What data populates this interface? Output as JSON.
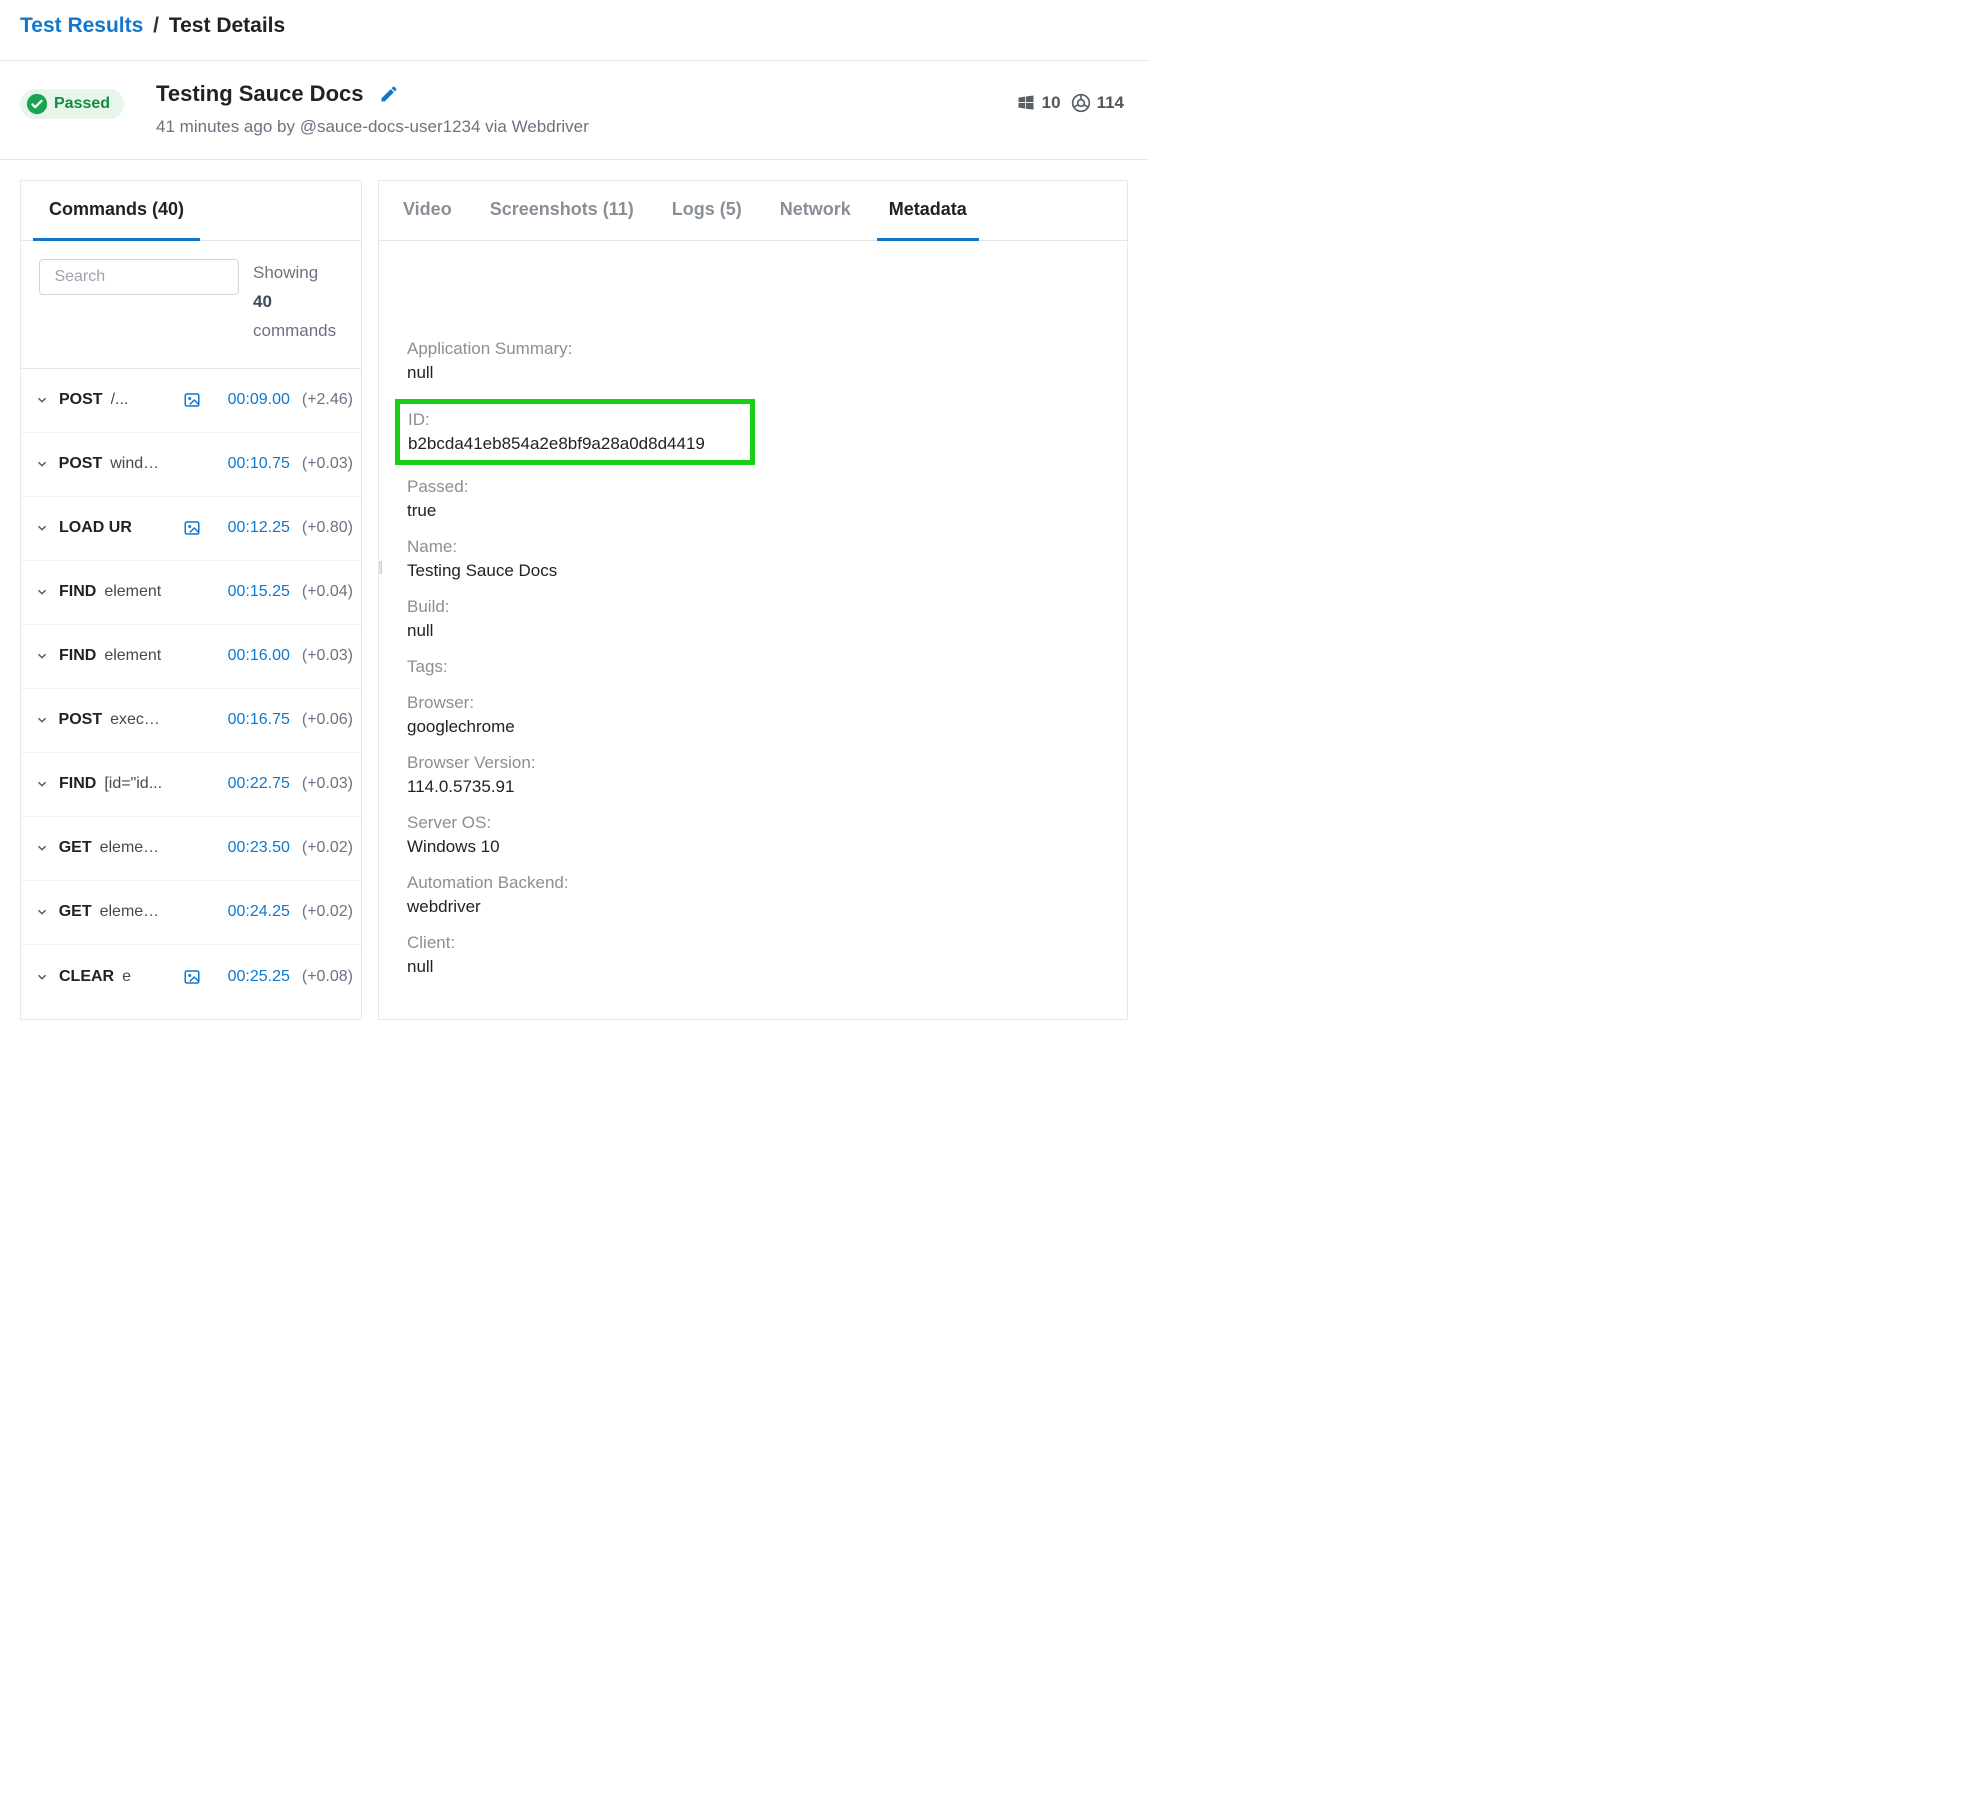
{
  "breadcrumb": {
    "parent": "Test Results",
    "current": "Test Details"
  },
  "test": {
    "status": "Passed",
    "title": "Testing Sauce Docs",
    "subtitle": "41 minutes ago by @sauce-docs-user1234 via Webdriver",
    "os_version": "10",
    "browser_version": "114"
  },
  "left": {
    "tab": "Commands (40)",
    "search_placeholder": "Search",
    "showing_prefix": "Showing",
    "showing_count": "40",
    "showing_suffix": "commands",
    "items": [
      {
        "method": "POST",
        "path": "/...",
        "pic": true,
        "time": "00:09.00",
        "delta": "(+2.46)"
      },
      {
        "method": "POST",
        "path": "windo...",
        "pic": false,
        "time": "00:10.75",
        "delta": "(+0.03)"
      },
      {
        "method": "LOAD UR",
        "path": "",
        "pic": true,
        "time": "00:12.25",
        "delta": "(+0.80)"
      },
      {
        "method": "FIND",
        "path": "element",
        "pic": false,
        "time": "00:15.25",
        "delta": "(+0.04)"
      },
      {
        "method": "FIND",
        "path": "element",
        "pic": false,
        "time": "00:16.00",
        "delta": "(+0.03)"
      },
      {
        "method": "POST",
        "path": "execu...",
        "pic": false,
        "time": "00:16.75",
        "delta": "(+0.06)"
      },
      {
        "method": "FIND",
        "path": "[id=\"id...",
        "pic": false,
        "time": "00:22.75",
        "delta": "(+0.03)"
      },
      {
        "method": "GET",
        "path": "elemen...",
        "pic": false,
        "time": "00:23.50",
        "delta": "(+0.02)"
      },
      {
        "method": "GET",
        "path": "elemen...",
        "pic": false,
        "time": "00:24.25",
        "delta": "(+0.02)"
      },
      {
        "method": "CLEAR",
        "path": "e",
        "pic": true,
        "time": "00:25.25",
        "delta": "(+0.08)"
      }
    ]
  },
  "right": {
    "tabs": {
      "video": "Video",
      "screenshots": "Screenshots (11)",
      "logs": "Logs (5)",
      "network": "Network",
      "metadata": "Metadata"
    },
    "metadata": {
      "app_summary_label": "Application Summary:",
      "app_summary_value": "null",
      "id_label": "ID:",
      "id_value": "b2bcda41eb854a2e8bf9a28a0d8d4419",
      "passed_label": "Passed:",
      "passed_value": "true",
      "name_label": "Name:",
      "name_value": "Testing Sauce Docs",
      "build_label": "Build:",
      "build_value": "null",
      "tags_label": "Tags:",
      "tags_value": "",
      "browser_label": "Browser:",
      "browser_value": "googlechrome",
      "browser_version_label": "Browser Version:",
      "browser_version_value": "114.0.5735.91",
      "server_os_label": "Server OS:",
      "server_os_value": "Windows 10",
      "automation_label": "Automation Backend:",
      "automation_value": "webdriver",
      "client_label": "Client:",
      "client_value": "null"
    }
  }
}
